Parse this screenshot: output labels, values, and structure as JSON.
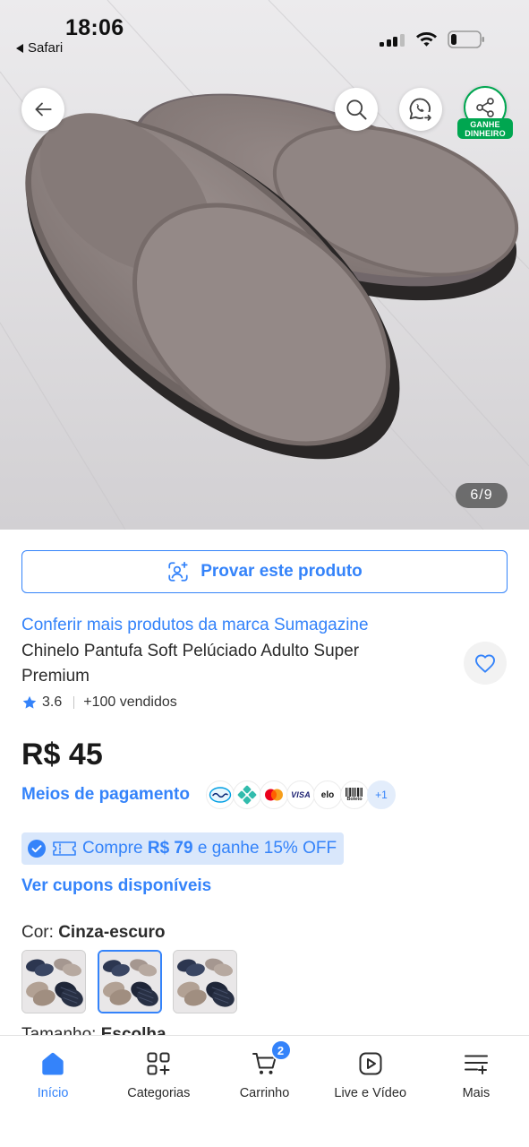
{
  "status_bar": {
    "time": "18:06",
    "back_app": "Safari",
    "signal_bars": 3,
    "battery_level": 0.2,
    "icons": {
      "signal": "cellular-signal-icon",
      "wifi": "wifi-icon",
      "battery": "battery-icon",
      "back": "back-caret-icon"
    }
  },
  "gallery": {
    "counter": "6/9",
    "share_badge": [
      "GANHE",
      "DINHEIRO"
    ],
    "icons": {
      "back": "arrow-left-icon",
      "search": "search-icon",
      "whatsapp": "whatsapp-share-icon",
      "share": "share-icon"
    }
  },
  "try_on": {
    "label": "Provar este produto",
    "icon": "person-sparkle-icon"
  },
  "product": {
    "brand_link": "Conferir mais produtos da marca Sumagazine",
    "title": "Chinelo Pantufa Soft Pelúciado Adulto Super Premium",
    "rating": "3.6",
    "sold": "+100 vendidos",
    "favorite_icon": "heart-outline-icon",
    "rating_icon": "star-icon"
  },
  "price": "R$ 45",
  "payment": {
    "label": "Meios de pagamento",
    "methods": [
      {
        "icon": "mercado-pago-icon"
      },
      {
        "icon": "pix-icon"
      },
      {
        "icon": "mastercard-icon"
      },
      {
        "icon": "visa-icon",
        "text": "VISA"
      },
      {
        "icon": "elo-icon",
        "text": "elo"
      },
      {
        "icon": "boleto-icon",
        "text": "Boleto"
      }
    ],
    "more": "+1"
  },
  "coupon": {
    "prefix": "Compre",
    "highlight": "R$ 79",
    "suffix": "e ganhe 15% OFF"
  },
  "coupons_link": "Ver cupons disponíveis",
  "variation": {
    "label": "Cor:",
    "value": "Cinza-escuro",
    "selected_index": 1
  },
  "size": {
    "label": "Tamanho:",
    "value": "Escolha"
  },
  "bottom_nav": [
    {
      "label": "Início",
      "icon": "home-icon",
      "active": true
    },
    {
      "label": "Categorias",
      "icon": "categories-grid-icon"
    },
    {
      "label": "Carrinho",
      "icon": "cart-icon",
      "badge": "2"
    },
    {
      "label": "Live e Vídeo",
      "icon": "play-video-icon"
    },
    {
      "label": "Mais",
      "icon": "menu-more-icon"
    }
  ],
  "colors": {
    "accent": "#3483fa",
    "share_green": "#00a650",
    "coupon_bg": "#d9e7fb",
    "text": "#1f1f1f"
  }
}
